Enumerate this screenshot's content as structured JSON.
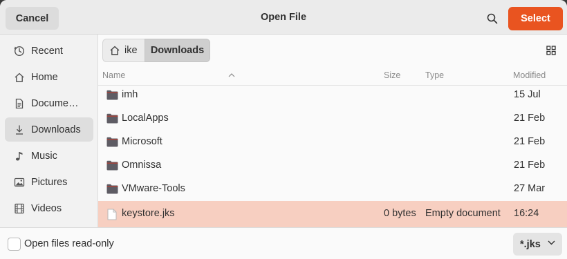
{
  "header": {
    "cancel_label": "Cancel",
    "title": "Open File",
    "select_label": "Select",
    "accent_color": "#e95420"
  },
  "sidebar": {
    "items": [
      {
        "label": "Recent",
        "icon": "clock-icon",
        "active": false
      },
      {
        "label": "Home",
        "icon": "home-icon",
        "active": false
      },
      {
        "label": "Docume…",
        "icon": "document-icon",
        "active": false
      },
      {
        "label": "Downloads",
        "icon": "download-icon",
        "active": true
      },
      {
        "label": "Music",
        "icon": "music-icon",
        "active": false
      },
      {
        "label": "Pictures",
        "icon": "picture-icon",
        "active": false
      },
      {
        "label": "Videos",
        "icon": "film-icon",
        "active": false
      }
    ]
  },
  "pathbar": {
    "home_label": "ike",
    "current_label": "Downloads"
  },
  "columns": {
    "name": "Name",
    "size": "Size",
    "type": "Type",
    "modified": "Modified"
  },
  "files": [
    {
      "name": "imh",
      "size": "",
      "type": "",
      "modified": "15 Jul",
      "kind": "folder"
    },
    {
      "name": "LocalApps",
      "size": "",
      "type": "",
      "modified": "21 Feb",
      "kind": "folder"
    },
    {
      "name": "Microsoft",
      "size": "",
      "type": "",
      "modified": "21 Feb",
      "kind": "folder"
    },
    {
      "name": "Omnissa",
      "size": "",
      "type": "",
      "modified": "21 Feb",
      "kind": "folder"
    },
    {
      "name": "VMware-Tools",
      "size": "",
      "type": "",
      "modified": "27 Mar",
      "kind": "folder"
    },
    {
      "name": "keystore.jks",
      "size": "0 bytes",
      "type": "Empty document",
      "modified": "16:24",
      "kind": "file",
      "selected": true
    }
  ],
  "footer": {
    "readonly_label": "Open files read-only",
    "readonly_checked": false,
    "filter_value": "*.jks"
  }
}
